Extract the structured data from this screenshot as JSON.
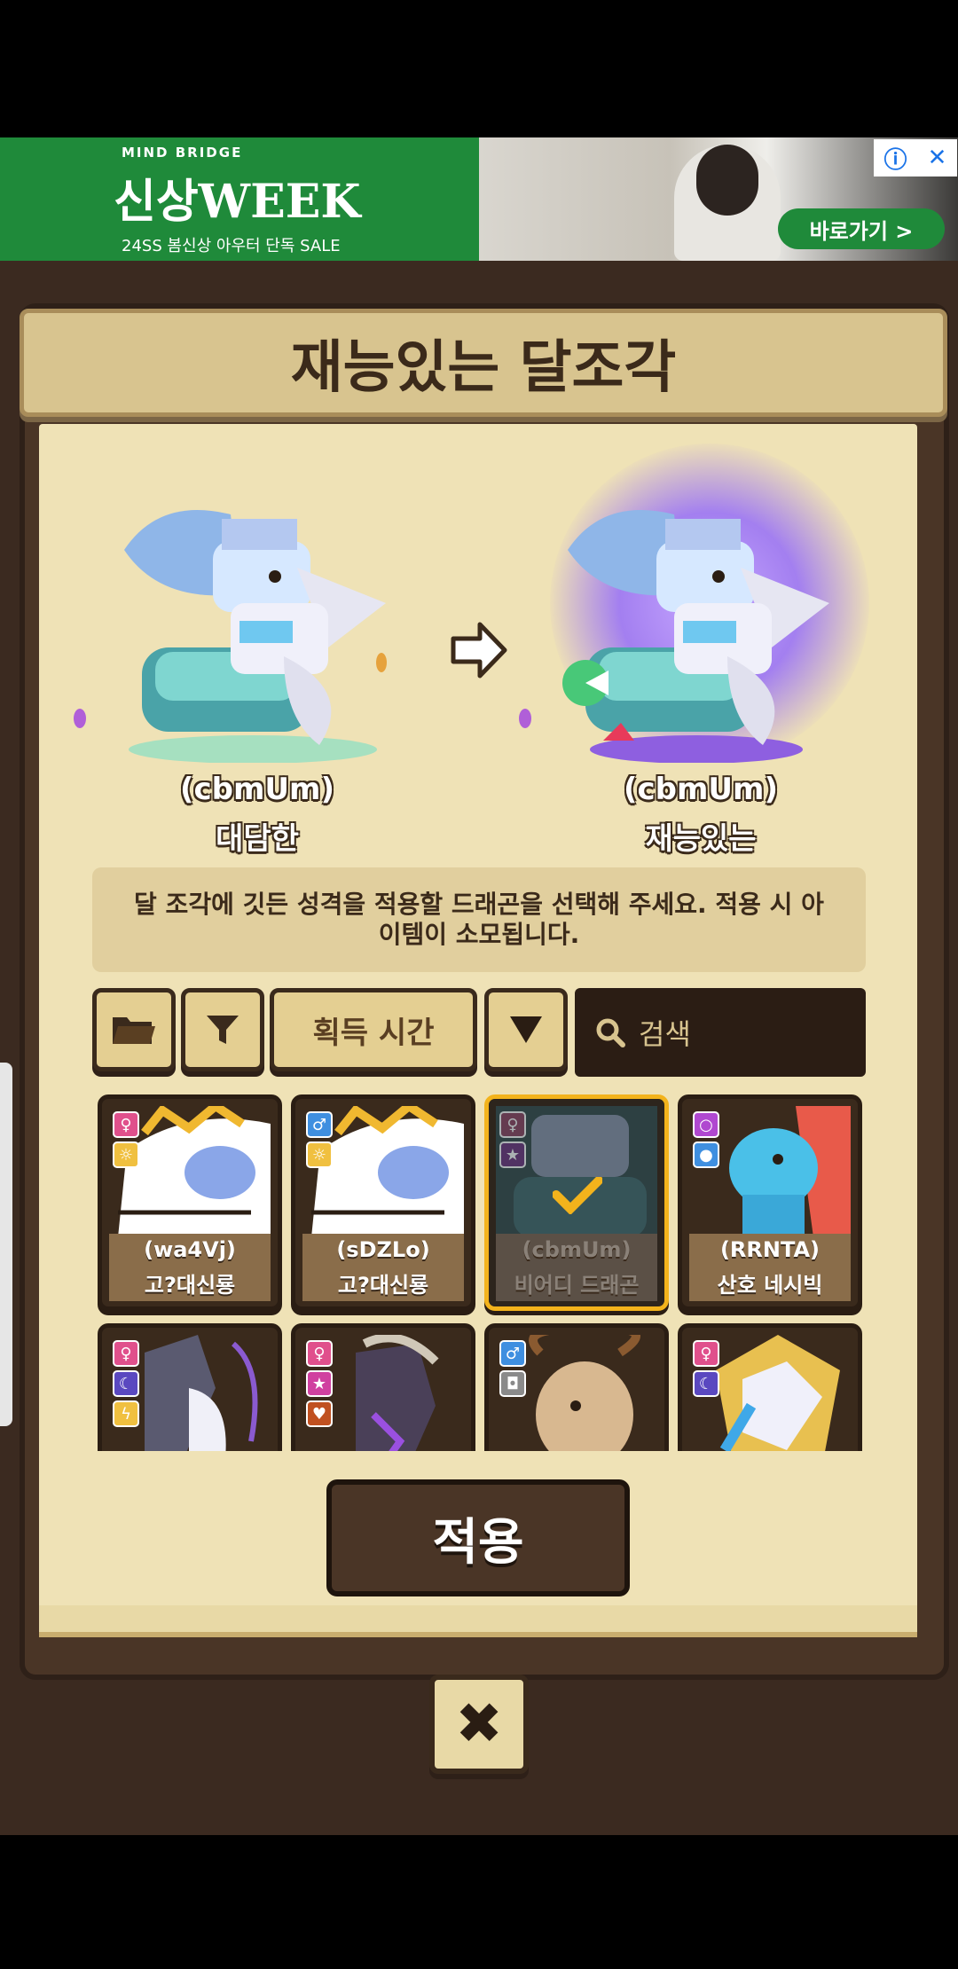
{
  "ad": {
    "brand": "MIND BRIDGE",
    "title": "신상WEEK",
    "subtitle": "24SS 봄신상 아우터 단독 SALE",
    "cta": "바로가기 >",
    "info_glyph": "ⓘ",
    "close_glyph": "✕"
  },
  "dialog": {
    "title": "재능있는 달조각",
    "before": {
      "name": "(cbmUm)",
      "trait": "대담한"
    },
    "after": {
      "name": "(cbmUm)",
      "trait": "재능있는"
    },
    "info": "달 조각에 깃든 성격을 적용할 드래곤을 선택해 주세요. 적용 시 아이템이 소모됩니다.",
    "toolbar": {
      "sort_label": "획득 시간",
      "search_placeholder": "검색"
    },
    "apply_label": "적용",
    "close_glyph": "✖"
  },
  "cards": [
    {
      "name": "(wa4Vj)",
      "kind": "고?대신룡",
      "gender": "female",
      "selected": false
    },
    {
      "name": "(sDZLo)",
      "kind": "고?대신룡",
      "gender": "male",
      "selected": false
    },
    {
      "name": "(cbmUm)",
      "kind": "비어디 드래곤",
      "gender": "female",
      "selected": true
    },
    {
      "name": "(RRNTA)",
      "kind": "산호 네시빅",
      "gender": "neutral",
      "selected": false
    },
    {
      "name": "",
      "kind": "",
      "gender": "female",
      "selected": false
    },
    {
      "name": "",
      "kind": "",
      "gender": "female",
      "selected": false
    },
    {
      "name": "",
      "kind": "",
      "gender": "male",
      "selected": false
    },
    {
      "name": "",
      "kind": "",
      "gender": "female",
      "selected": false
    }
  ],
  "colors": {
    "female": "#e0508c",
    "male": "#3f8fe0",
    "neutral": "#b048d0",
    "selected_border": "#f3b31c"
  }
}
